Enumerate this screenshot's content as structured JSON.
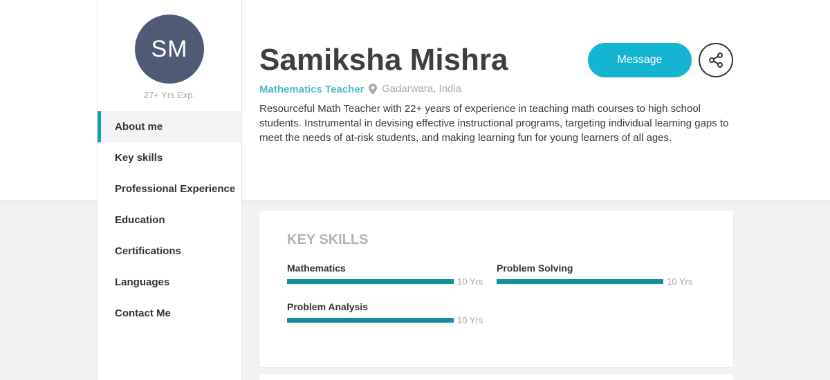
{
  "profile": {
    "initials": "SM",
    "experience": "27+ Yrs Exp.",
    "name": "Samiksha Mishra",
    "role": "Mathematics Teacher",
    "location": "Gadarwara, India",
    "bio": "Resourceful Math Teacher with 22+ years of experience in teaching math courses to high school students. Instrumental in devising effective instructional programs, targeting individual learning gaps to meet the needs of at-risk students, and making learning fun for young learners of all ages."
  },
  "actions": {
    "message_label": "Message",
    "share_icon": "share-icon"
  },
  "nav": {
    "items": [
      {
        "label": "About me",
        "active": true
      },
      {
        "label": "Key skills",
        "active": false
      },
      {
        "label": "Professional Experience",
        "active": false
      },
      {
        "label": "Education",
        "active": false
      },
      {
        "label": "Certifications",
        "active": false
      },
      {
        "label": "Languages",
        "active": false
      },
      {
        "label": "Contact Me",
        "active": false
      }
    ]
  },
  "skills_section": {
    "title": "KEY SKILLS",
    "skills": [
      {
        "name": "Mathematics",
        "years": "10 Yrs",
        "level": 1.0
      },
      {
        "name": "Problem Solving",
        "years": "10 Yrs",
        "level": 1.0
      },
      {
        "name": "Problem Analysis",
        "years": "10 Yrs",
        "level": 1.0
      }
    ]
  },
  "colors": {
    "accent": "#14b5d0",
    "avatar": "#4f5b76",
    "bar": "#138f9f",
    "role": "#4fb9c7"
  }
}
